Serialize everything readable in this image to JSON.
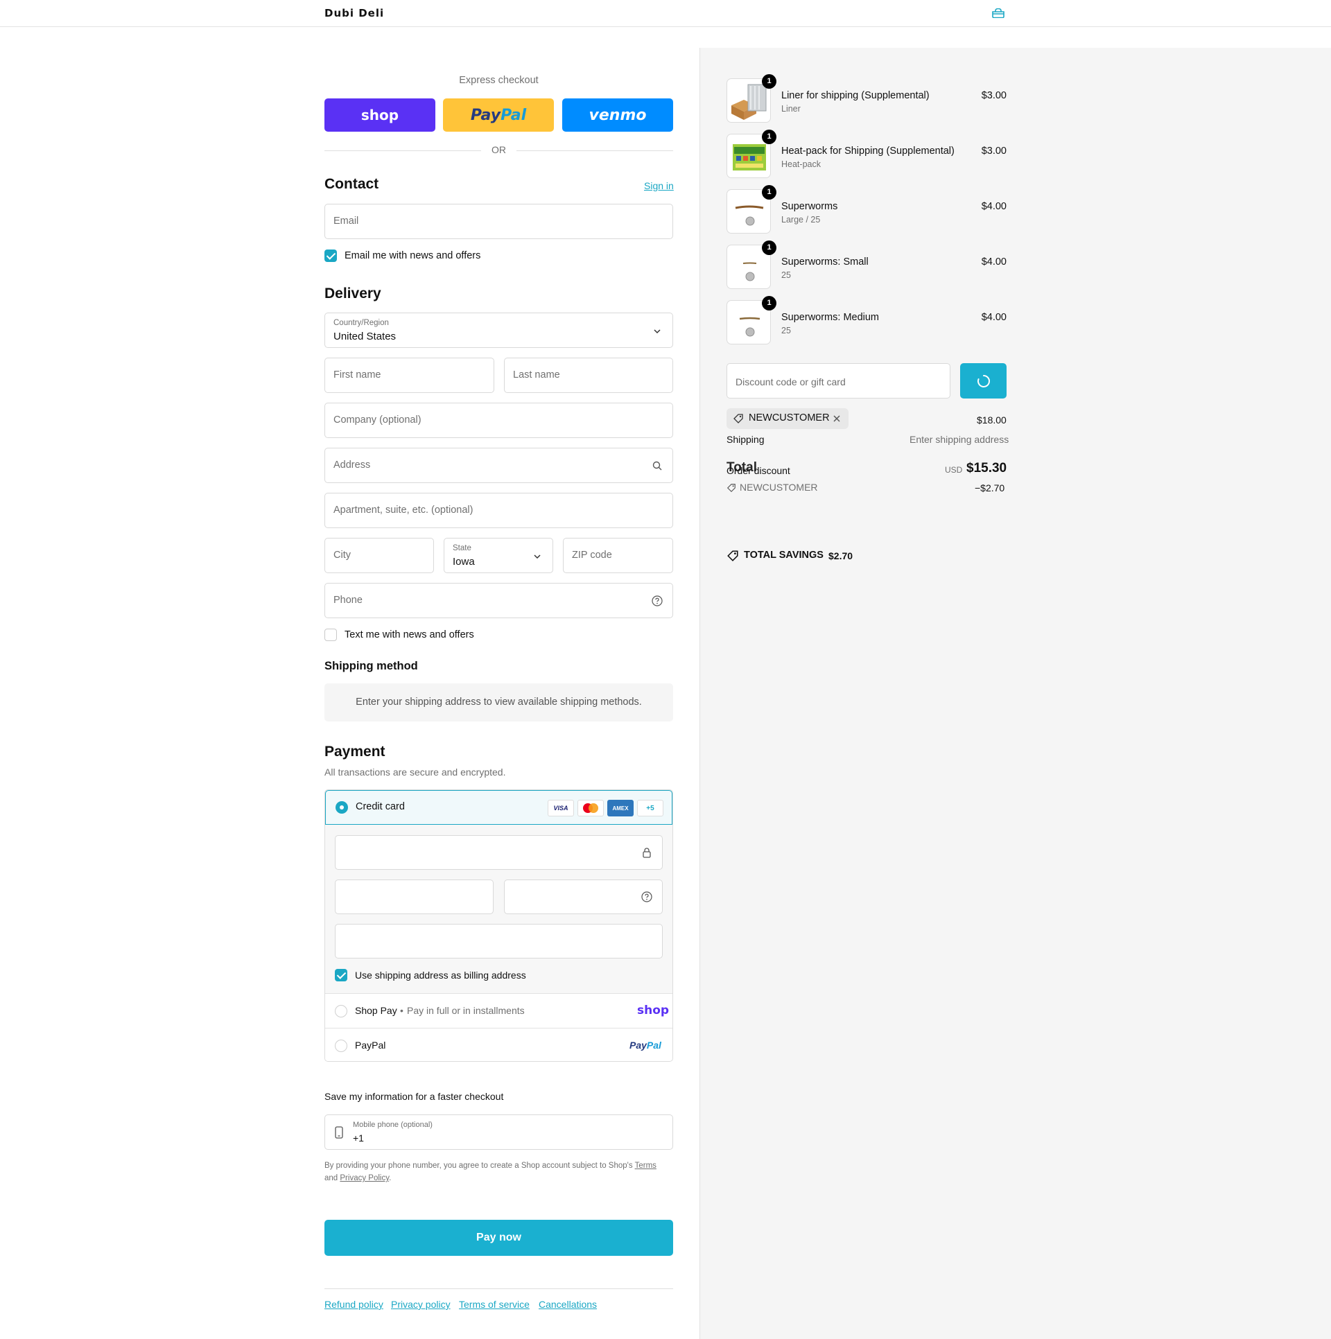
{
  "header": {
    "store_name": "Dubi Deli",
    "cart_icon": "bag-icon"
  },
  "express": {
    "label": "Express checkout",
    "shop_label": "shop",
    "paypal_label_a": "Pay",
    "paypal_label_b": "Pal",
    "venmo_label": "venmo",
    "or": "OR"
  },
  "contact": {
    "title": "Contact",
    "sign_in": "Sign in",
    "email_placeholder": "Email",
    "email_opt_in": "Email me with news and offers",
    "email_opt_in_checked": true
  },
  "delivery": {
    "title": "Delivery",
    "country_label": "Country/Region",
    "country_value": "United States",
    "first_name": "First name",
    "last_name": "Last name",
    "company": "Company (optional)",
    "address": "Address",
    "apartment": "Apartment, suite, etc. (optional)",
    "city": "City",
    "state_label": "State",
    "state_value": "Iowa",
    "zip": "ZIP code",
    "phone": "Phone",
    "text_opt_in": "Text me with news and offers",
    "text_opt_in_checked": false
  },
  "shipping_method": {
    "title": "Shipping method",
    "info": "Enter your shipping address to view available shipping methods."
  },
  "payment": {
    "title": "Payment",
    "subtitle": "All transactions are secure and encrypted.",
    "credit_card": "Credit card",
    "card_visa": "VISA",
    "card_amex": "AMEX",
    "card_more": "+5",
    "billing_same": "Use shipping address as billing address",
    "billing_same_checked": true,
    "shop_pay": "Shop Pay",
    "shop_pay_sep": "•",
    "shop_pay_desc": "Pay in full or in installments",
    "shop_pay_logo": "shop",
    "paypal": "PayPal",
    "paypal_logo_a": "Pay",
    "paypal_logo_b": "Pal"
  },
  "remember": {
    "title": "Save my information for a faster checkout",
    "mobile_label": "Mobile phone (optional)",
    "mobile_value": "+1",
    "legal_a": "By providing your phone number, you agree to create a Shop account subject to Shop's",
    "legal_terms": "Terms",
    "legal_and": "and",
    "legal_privacy": "Privacy Policy",
    "legal_end": "."
  },
  "pay_now": "Pay now",
  "footer": {
    "links": [
      "Refund policy",
      "Privacy policy",
      "Terms of service",
      "Cancellations"
    ]
  },
  "summary": {
    "items": [
      {
        "name": "Liner for shipping (Supplemental)",
        "variant": "Liner",
        "price": "$3.00",
        "qty": "1"
      },
      {
        "name": "Heat-pack for Shipping (Supplemental)",
        "variant": "Heat-pack",
        "price": "$3.00",
        "qty": "1"
      },
      {
        "name": "Superworms",
        "variant": "Large / 25",
        "price": "$4.00",
        "qty": "1"
      },
      {
        "name": "Superworms: Small",
        "variant": "25",
        "price": "$4.00",
        "qty": "1"
      },
      {
        "name": "Superworms: Medium",
        "variant": "25",
        "price": "$4.00",
        "qty": "1"
      }
    ],
    "discount_placeholder": "Discount code or gift card",
    "applied_code": "NEWCUSTOMER",
    "subtotal": "$18.00",
    "shipping_label": "Shipping",
    "shipping_value": "Enter shipping address",
    "order_discount_label": "Order discount",
    "total_label": "Total",
    "currency": "USD",
    "total": "$15.30",
    "discount_code_line": "NEWCUSTOMER",
    "discount_amount": "−$2.70",
    "savings_label": "TOTAL SAVINGS",
    "savings_value": "$2.70"
  },
  "colors": {
    "accent": "#1aa7c4",
    "shop": "#5a31f4",
    "paypal_btn": "#ffc439",
    "venmo": "#008cff"
  }
}
